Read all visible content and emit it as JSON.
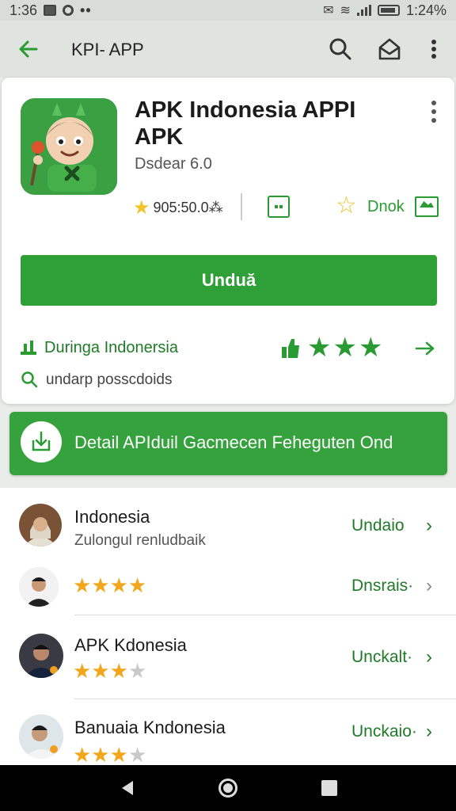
{
  "status_bar": {
    "time_left": "1:36",
    "time_right": "1:24%"
  },
  "app_bar": {
    "title": "KPI- APP"
  },
  "app": {
    "title": "APK Indonesia APPI APK",
    "subtitle": "Dsdear 6.0",
    "rating_text": "905:50.0⁂",
    "secondary_label": "Dnok",
    "install_label": "Unduă"
  },
  "ranking": {
    "label": "Duringa Indonersia",
    "stars": "★★★"
  },
  "search": {
    "label": "undarp posscdoids"
  },
  "banner": {
    "label": "Detail APIduil Gacmecen Feheguten Ond"
  },
  "list": [
    {
      "name": "Indonesia",
      "desc": "Zulongul renludbaik",
      "action": "Undaio",
      "rating": null
    },
    {
      "name": "",
      "desc": "",
      "action": "Dnsrais·",
      "rating": 4
    },
    {
      "name": "APK Kdonesia",
      "desc": "",
      "action": "Unckalt·",
      "rating": 3
    },
    {
      "name": "Banuaia Kndonesia",
      "desc": "",
      "action": "Unckaio·",
      "rating": 3
    }
  ],
  "colors": {
    "accent_green": "#2f9f37",
    "star_gold": "#f2a71b"
  },
  "icons": [
    "back-arrow-icon",
    "search-icon",
    "share-icon",
    "more-vert-icon",
    "trophy-icon",
    "thumb-icon",
    "arrow-right-icon",
    "download-icon",
    "chevron-right-icon"
  ]
}
